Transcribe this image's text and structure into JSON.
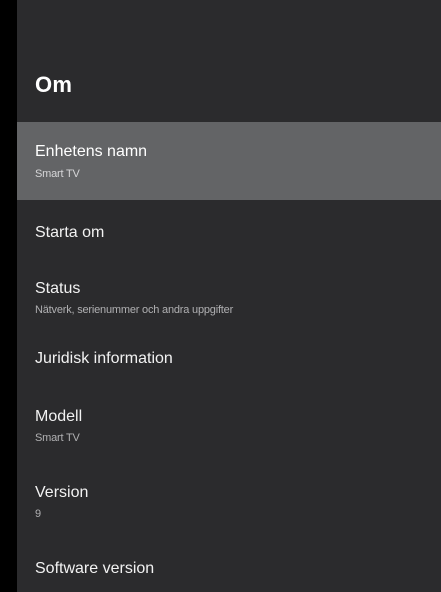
{
  "screen": {
    "title": "Om"
  },
  "items": [
    {
      "label": "Enhetens namn",
      "sub": "Smart TV"
    },
    {
      "label": "Starta om",
      "sub": ""
    },
    {
      "label": "Status",
      "sub": "Nätverk, serienummer och andra uppgifter"
    },
    {
      "label": "Juridisk information",
      "sub": ""
    },
    {
      "label": "Modell",
      "sub": "Smart TV"
    },
    {
      "label": "Version",
      "sub": "9"
    },
    {
      "label": "Software version",
      "sub": ""
    }
  ],
  "colors": {
    "background": "#2b2b2d",
    "focused_row": "#636466",
    "outer": "#000000"
  }
}
